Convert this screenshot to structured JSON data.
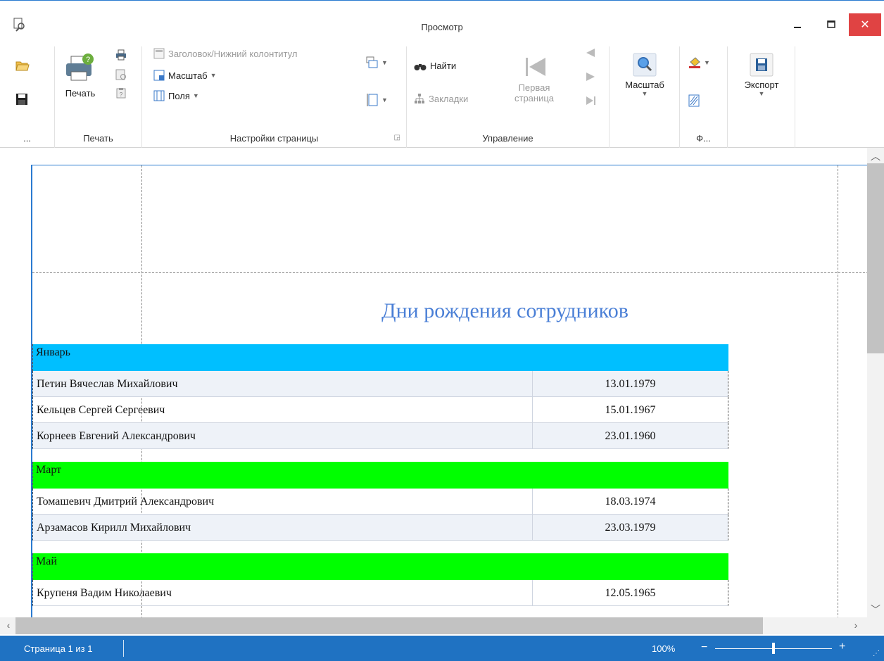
{
  "window": {
    "title": "Просмотр",
    "close_glyph": "✕"
  },
  "ribbon": {
    "file_group": {
      "caption": "..."
    },
    "print_group": {
      "print_label": "Печать",
      "caption": "Печать"
    },
    "page_setup": {
      "header_footer": "Заголовок/Нижний колонтитул",
      "scale": "Масштаб",
      "margins": "Поля",
      "caption": "Настройки страницы"
    },
    "navigation": {
      "find": "Найти",
      "bookmarks": "Закладки",
      "first_page_line1": "Первая",
      "first_page_line2": "страница",
      "caption": "Управление"
    },
    "zoom_group": {
      "zoom_label": "Масштаб"
    },
    "background_group": {
      "caption": "Ф..."
    },
    "export_group": {
      "export_label": "Экспорт"
    }
  },
  "report": {
    "title": "Дни рождения сотрудников",
    "groups": [
      {
        "month": "Январь",
        "color": "#00bfff",
        "rows": [
          {
            "name": "Петин Вячеслав Михайлович",
            "date": "13.01.1979"
          },
          {
            "name": "Кельцев Сергей Сергеевич",
            "date": "15.01.1967"
          },
          {
            "name": "Корнеев Евгений Александрович",
            "date": "23.01.1960"
          }
        ]
      },
      {
        "month": "Март",
        "color": "#00ff00",
        "rows": [
          {
            "name": "Томашевич Дмитрий Александрович",
            "date": "18.03.1974"
          },
          {
            "name": "Арзамасов Кирилл Михайлович",
            "date": "23.03.1979"
          }
        ]
      },
      {
        "month": "Май",
        "color": "#00ff00",
        "rows": [
          {
            "name": "Крупеня Вадим Николаевич",
            "date": "12.05.1965"
          }
        ]
      }
    ]
  },
  "statusbar": {
    "page_info": "Страница 1 из 1",
    "zoom": "100%",
    "zoom_minus": "−",
    "zoom_plus": "+"
  },
  "colors": {
    "accent": "#1f72c2",
    "title_blue": "#4a7fd6",
    "close_red": "#e04343"
  }
}
